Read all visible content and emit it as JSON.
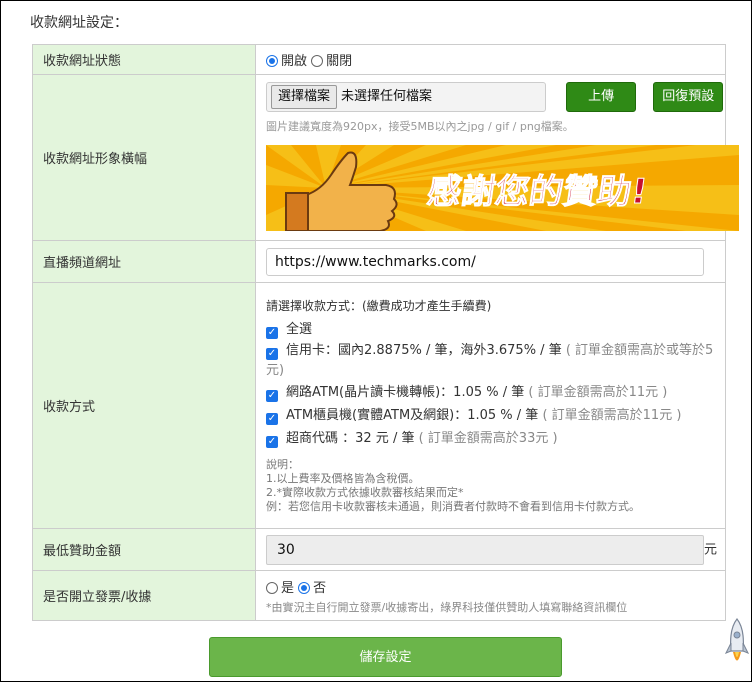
{
  "section_title": "收款網址設定：",
  "rows": {
    "status": {
      "label": "收款網址狀態",
      "options": [
        "開啟",
        "關閉"
      ],
      "selected": "開啟"
    },
    "banner": {
      "label": "收款網址形象橫幅",
      "choose_file_button": "選擇檔案",
      "no_file_text": "未選擇任何檔案",
      "upload_button": "上傳",
      "reset_button": "回復預設",
      "hint": "圖片建議寬度為920px，接受5MB以內之jpg / gif / png檔案。",
      "banner_text": "感謝您的贊助!"
    },
    "channel_url": {
      "label": "直播頻道網址",
      "value": "https://www.techmarks.com/"
    },
    "payment": {
      "label": "收款方式",
      "prompt": "請選擇收款方式：(繳費成功才產生手續費)",
      "select_all": "全選",
      "methods": [
        {
          "name": "信用卡：國內2.8875% / 筆，海外3.675% / 筆",
          "note": "( 訂單金額需高於或等於5",
          "note2": "元)"
        },
        {
          "name": "網路ATM(晶片讀卡機轉帳)：1.05 % / 筆",
          "note": "( 訂單金額需高於11元 )"
        },
        {
          "name": "ATM櫃員機(實體ATM及網銀)：1.05 % / 筆",
          "note": "( 訂單金額需高於11元 )"
        },
        {
          "name": "超商代碼 ：32 元 / 筆",
          "note": "( 訂單金額需高於33元 )"
        }
      ],
      "notes": [
        "說明：",
        "1.以上費率及價格皆為含稅價。",
        "2.*實際收款方式依據收款審核結果而定*",
        "例：若您信用卡收款審核未通過，則消費者付款時不會看到信用卡付款方式。"
      ]
    },
    "min_amount": {
      "label": "最低贊助金額",
      "value": "30",
      "unit": "元"
    },
    "invoice": {
      "label": "是否開立發票/收據",
      "options": [
        "是",
        "否"
      ],
      "selected": "否",
      "note": "*由實況主自行開立發票/收據寄出，綠界科技僅供贊助人填寫聯絡資訊欄位"
    }
  },
  "save_button": "儲存設定",
  "colors": {
    "label_bg": "#e3f5dc",
    "accent_blue": "#1a73e8",
    "button_green": "#2f8a16",
    "save_green": "#6bb54a",
    "banner_yellow": "#f0b400",
    "banner_text_red": "#c8102e"
  },
  "icons": [
    "radio-icon",
    "checkbox-icon",
    "thumbs-up-icon",
    "rocket-icon"
  ]
}
